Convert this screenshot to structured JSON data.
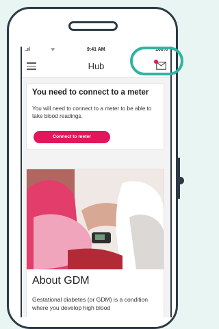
{
  "status_bar": {
    "signal": "..ıl",
    "wifi": "ᯤ",
    "time": "9:41 AM",
    "battery": "100%"
  },
  "appbar": {
    "title": "Hub",
    "menu_icon": "hamburger-menu-icon",
    "mail_icon": "mail-icon",
    "notification_color": "#e0185b"
  },
  "meter_card": {
    "heading": "You need to connect to a meter",
    "body": "You will need to connect to a meter to be able to take blood readings.",
    "button_label": "Connect to meter",
    "button_color": "#e0185b"
  },
  "gdm_card": {
    "image": "pregnant-woman-blood-test-photo",
    "heading": "About GDM",
    "body": "Gestational diabetes (or GDM) is a condition where you develop high blood"
  },
  "highlight_color": "#2fb3a1"
}
